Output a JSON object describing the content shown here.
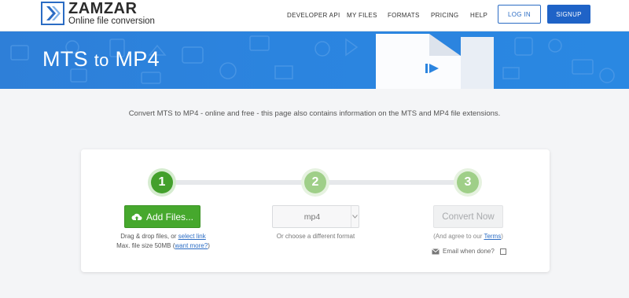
{
  "brand": {
    "name": "ZAMZAR",
    "tagline": "Online file conversion"
  },
  "nav": {
    "items": [
      "DEVELOPER API",
      "MY FILES",
      "FORMATS",
      "PRICING",
      "HELP"
    ],
    "login_label": "LOG IN",
    "signup_label": "SIGNUP"
  },
  "banner": {
    "from_format": "MTS",
    "connector": "to",
    "to_format": "MP4"
  },
  "intro_text": "Convert MTS to MP4 - online and free - this page also contains information on the MTS and MP4 file extensions.",
  "converter": {
    "steps": [
      "1",
      "2",
      "3"
    ],
    "active_step": 1,
    "add_files_label": "Add Files...",
    "drag_drop_text": "Drag & drop files, or",
    "select_link_text": "select link",
    "max_size_text": "Max. file size 50MB",
    "want_more_link": "want more?",
    "format_value": "mp4",
    "format_hint": "Or choose a different format",
    "convert_label": "Convert Now",
    "terms_prefix": "(And agree to our",
    "terms_link": "Terms",
    "terms_suffix": ")",
    "email_label": "Email when done?"
  },
  "colors": {
    "brand_blue": "#1f63c7",
    "banner_blue": "#2b84df",
    "active_green": "#43a02c",
    "idle_green": "#9fcf88"
  },
  "icons": {
    "logo": "zamzar-chevron-logo",
    "add_files": "upload-cloud-icon",
    "select": "chevron-down-icon",
    "email": "envelope-icon",
    "banner_file": "play-file-icon"
  }
}
